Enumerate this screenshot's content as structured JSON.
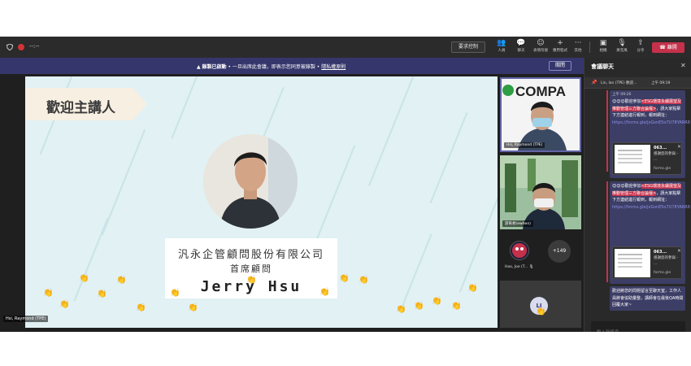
{
  "topbar": {
    "timer": "--:--",
    "raise_hand_label": "要求控制",
    "tools": [
      {
        "icon": "people-icon",
        "glyph": "👥",
        "label": "人員"
      },
      {
        "icon": "chat-icon",
        "glyph": "💬",
        "label": "聊天"
      },
      {
        "icon": "reactions-icon",
        "glyph": "☺",
        "label": "表情符號"
      },
      {
        "icon": "apps-icon",
        "glyph": "+",
        "label": "應用程式"
      },
      {
        "icon": "more-icon",
        "glyph": "···",
        "label": "其他"
      },
      {
        "icon": "camera-icon",
        "glyph": "▣",
        "label": "相機"
      },
      {
        "icon": "mic-off-icon",
        "glyph": "🎙",
        "label": "麥克風"
      },
      {
        "icon": "share-icon",
        "glyph": "⇧",
        "label": "分享"
      }
    ],
    "leave_label": "離開"
  },
  "recording_banner": {
    "bold": "錄製已啟動",
    "text": " • 一旦出席此會議，即表示您同意被錄製 • ",
    "link": "隱私權原則",
    "close_label": "關閉"
  },
  "slide": {
    "welcome": "歡迎主講人",
    "company": "汎永企管顧問股份有限公司",
    "role": "首席顧問",
    "name": "Jerry Hsu",
    "self_label": "Hsi, Raymond (TPE)"
  },
  "participants": {
    "tile1_label": "Hsi, Raymond (TPE)",
    "tile1_logo": "COMPA",
    "tile2_label": "游育君(ewhen)",
    "hao_label": "Hao, Joe (T...",
    "more_count": "+149",
    "li_initials": "LI"
  },
  "chat": {
    "title": "會議聊天",
    "pinned_name": "Lin, Ian (TPE)",
    "pinned_preview": "歡迎...",
    "pinned_time": "上午 09:19",
    "msg1": {
      "time": "上午 09:26",
      "head": "😊😊😊歡迎參加",
      "highlight": "<ESG環境永續展望及推動管理三方聯合論壇>",
      "body": "，請大家點擊下方連結進行報到，報到網址：",
      "link": "https://forms.gle/jxGsnE5o7U78YARR8",
      "card_title": "063...",
      "card_sub": "感謝您的參與 - ...",
      "card_domain": "forms.gle"
    },
    "msg2": {
      "head": "😊😊😊歡迎參加",
      "highlight": "<ESG環境永續展望及推動管理三方聯合論壇>",
      "body": "，請大家點擊下方連結進行報到，報到網址：",
      "link": "https://forms.gle/jxGsnE5o7U78YARR8",
      "card_title": "063...",
      "card_sub": "感謝您的參與 - ...",
      "card_domain": "forms.gle"
    },
    "msg3": "歡迎將您的問題留言至聊天室，工作人員將會協助彙整，講師會在最後QA時間回覆大家~",
    "input_placeholder": "輸入新訊息"
  }
}
